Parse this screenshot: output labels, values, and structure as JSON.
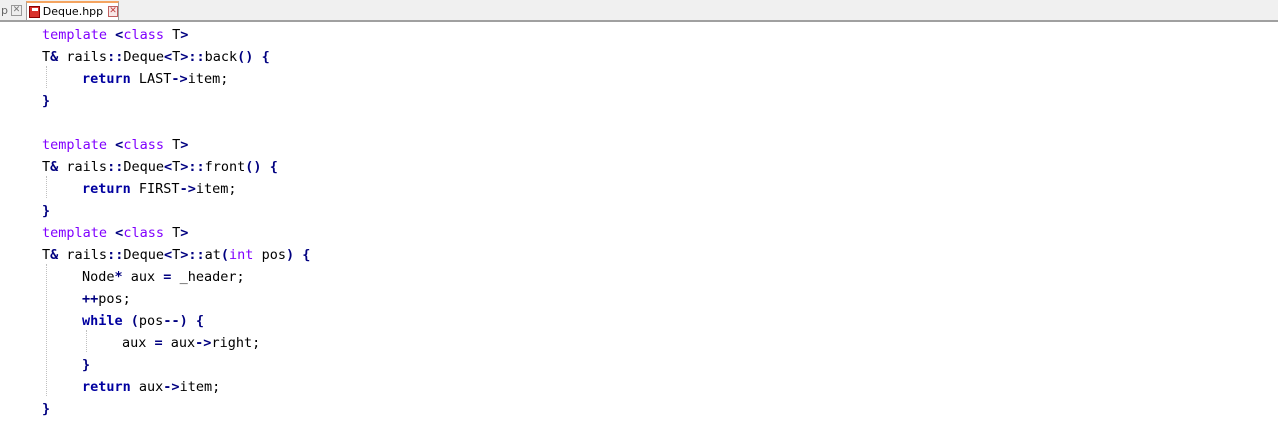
{
  "tabs": [
    {
      "label": "p",
      "active": false
    },
    {
      "label": "Deque.hpp",
      "active": true
    }
  ],
  "code": {
    "l1": {
      "kw": "template",
      "op1": "<",
      "kw2": "class",
      "t": " T",
      "op2": ">"
    },
    "l2": {
      "a": "T",
      "op1": "&",
      "b": " rails",
      "op2": "::",
      "c": "Deque",
      "op3": "<",
      "d": "T",
      "op4": ">::",
      "e": "back",
      "op5": "()",
      "op6": "{"
    },
    "l3": {
      "kw": "return",
      "a": " LAST",
      "op1": "->",
      "b": "item;"
    },
    "l4": {
      "op": "}"
    },
    "l6": {
      "kw": "template",
      "op1": "<",
      "kw2": "class",
      "t": " T",
      "op2": ">"
    },
    "l7": {
      "a": "T",
      "op1": "&",
      "b": " rails",
      "op2": "::",
      "c": "Deque",
      "op3": "<",
      "d": "T",
      "op4": ">::",
      "e": "front",
      "op5": "()",
      "op6": "{"
    },
    "l8": {
      "kw": "return",
      "a": " FIRST",
      "op1": "->",
      "b": "item;"
    },
    "l9": {
      "op": "}"
    },
    "l10": {
      "kw": "template",
      "op1": "<",
      "kw2": "class",
      "t": " T",
      "op2": ">"
    },
    "l11": {
      "a": "T",
      "op1": "&",
      "b": " rails",
      "op2": "::",
      "c": "Deque",
      "op3": "<",
      "d": "T",
      "op4": ">::",
      "e": "at",
      "op5": "(",
      "ty": "int",
      "f": " pos",
      "op6": ")",
      "op7": "{"
    },
    "l12": {
      "a": "Node",
      "op1": "*",
      "b": " aux ",
      "op2": "=",
      "c": " _header;"
    },
    "l13": {
      "op": "++",
      "a": "pos;"
    },
    "l14": {
      "kw": "while",
      "op1": "(",
      "a": "pos",
      "op2": "--)",
      "op3": "{"
    },
    "l15": {
      "a": "aux ",
      "op1": "=",
      "b": " aux",
      "op2": "->",
      "c": "right;"
    },
    "l16": {
      "op": "}"
    },
    "l17": {
      "kw": "return",
      "a": " aux",
      "op1": "->",
      "b": "item;"
    },
    "l18": {
      "op": "}"
    }
  }
}
